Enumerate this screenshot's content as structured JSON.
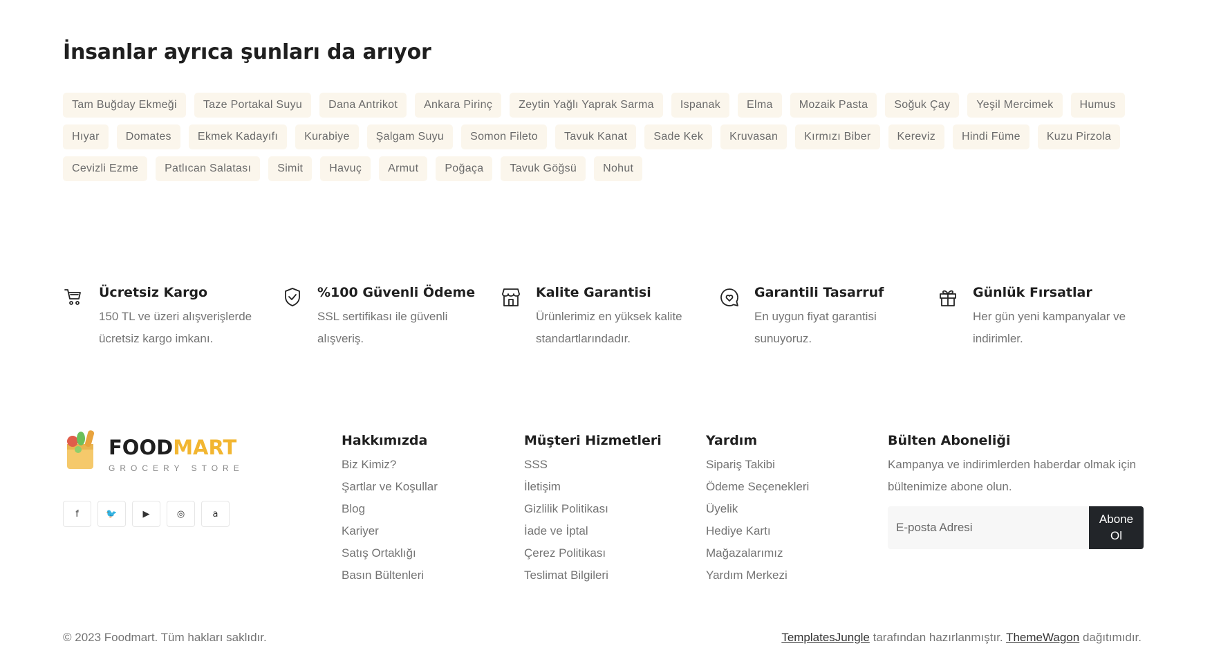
{
  "tags_section": {
    "title": "İnsanlar ayrıca şunları da arıyor",
    "tags": [
      "Tam Buğday Ekmeği",
      "Taze Portakal Suyu",
      "Dana Antrikot",
      "Ankara Pirinç",
      "Zeytin Yağlı Yaprak Sarma",
      "Ispanak",
      "Elma",
      "Mozaik Pasta",
      "Soğuk Çay",
      "Yeşil Mercimek",
      "Humus",
      "Hıyar",
      "Domates",
      "Ekmek Kadayıfı",
      "Kurabiye",
      "Şalgam Suyu",
      "Somon Fileto",
      "Tavuk Kanat",
      "Sade Kek",
      "Kruvasan",
      "Kırmızı Biber",
      "Kereviz",
      "Hindi Füme",
      "Kuzu Pirzola",
      "Cevizli Ezme",
      "Patlıcan Salatası",
      "Simit",
      "Havuç",
      "Armut",
      "Poğaça",
      "Tavuk Göğsü",
      "Nohut"
    ]
  },
  "features": [
    {
      "icon": "cart-icon",
      "title": "Ücretsiz Kargo",
      "desc": "150 TL ve üzeri alışverişlerde ücretsiz kargo imkanı."
    },
    {
      "icon": "shield-check-icon",
      "title": "%100 Güvenli Ödeme",
      "desc": "SSL sertifikası ile güvenli alışveriş."
    },
    {
      "icon": "store-icon",
      "title": "Kalite Garantisi",
      "desc": "Ürünlerimiz en yüksek kalite standartlarındadır."
    },
    {
      "icon": "heart-chat-icon",
      "title": "Garantili Tasarruf",
      "desc": "En uygun fiyat garantisi sunuyoruz."
    },
    {
      "icon": "gift-icon",
      "title": "Günlük Fırsatlar",
      "desc": "Her gün yeni kampanyalar ve indirimler."
    }
  ],
  "footer": {
    "brand": {
      "food": "FOOD",
      "mart": "MART",
      "tagline": "GROCERY STORE"
    },
    "socials": [
      {
        "icon": "facebook-icon",
        "glyph": "f"
      },
      {
        "icon": "twitter-icon",
        "glyph": "🐦"
      },
      {
        "icon": "youtube-icon",
        "glyph": "▶"
      },
      {
        "icon": "instagram-icon",
        "glyph": "◎"
      },
      {
        "icon": "amazon-icon",
        "glyph": "a"
      }
    ],
    "columns": [
      {
        "title": "Hakkımızda",
        "links": [
          "Biz Kimiz?",
          "Şartlar ve Koşullar",
          "Blog",
          "Kariyer",
          "Satış Ortaklığı",
          "Basın Bültenleri"
        ]
      },
      {
        "title": "Müşteri Hizmetleri",
        "links": [
          "SSS",
          "İletişim",
          "Gizlilik Politikası",
          "İade ve İptal",
          "Çerez Politikası",
          "Teslimat Bilgileri"
        ]
      },
      {
        "title": "Yardım",
        "links": [
          "Sipariş Takibi",
          "Ödeme Seçenekleri",
          "Üyelik",
          "Hediye Kartı",
          "Mağazalarımız",
          "Yardım Merkezi"
        ]
      }
    ],
    "newsletter": {
      "title": "Bülten Aboneliği",
      "desc": "Kampanya ve indirimlerden haberdar olmak için bültenimize abone olun.",
      "placeholder": "E-posta Adresi",
      "button": "Abone Ol"
    },
    "copyright": "© 2023 Foodmart. Tüm hakları saklıdır.",
    "credit": {
      "link1": "TemplatesJungle",
      "middle": " tarafından hazırlanmıştır. ",
      "link2": "ThemeWagon",
      "end": " dağıtımıdır."
    }
  },
  "colors": {
    "accent": "#f2b631",
    "tag_bg": "#fbf6ec",
    "button_bg": "#222529"
  }
}
